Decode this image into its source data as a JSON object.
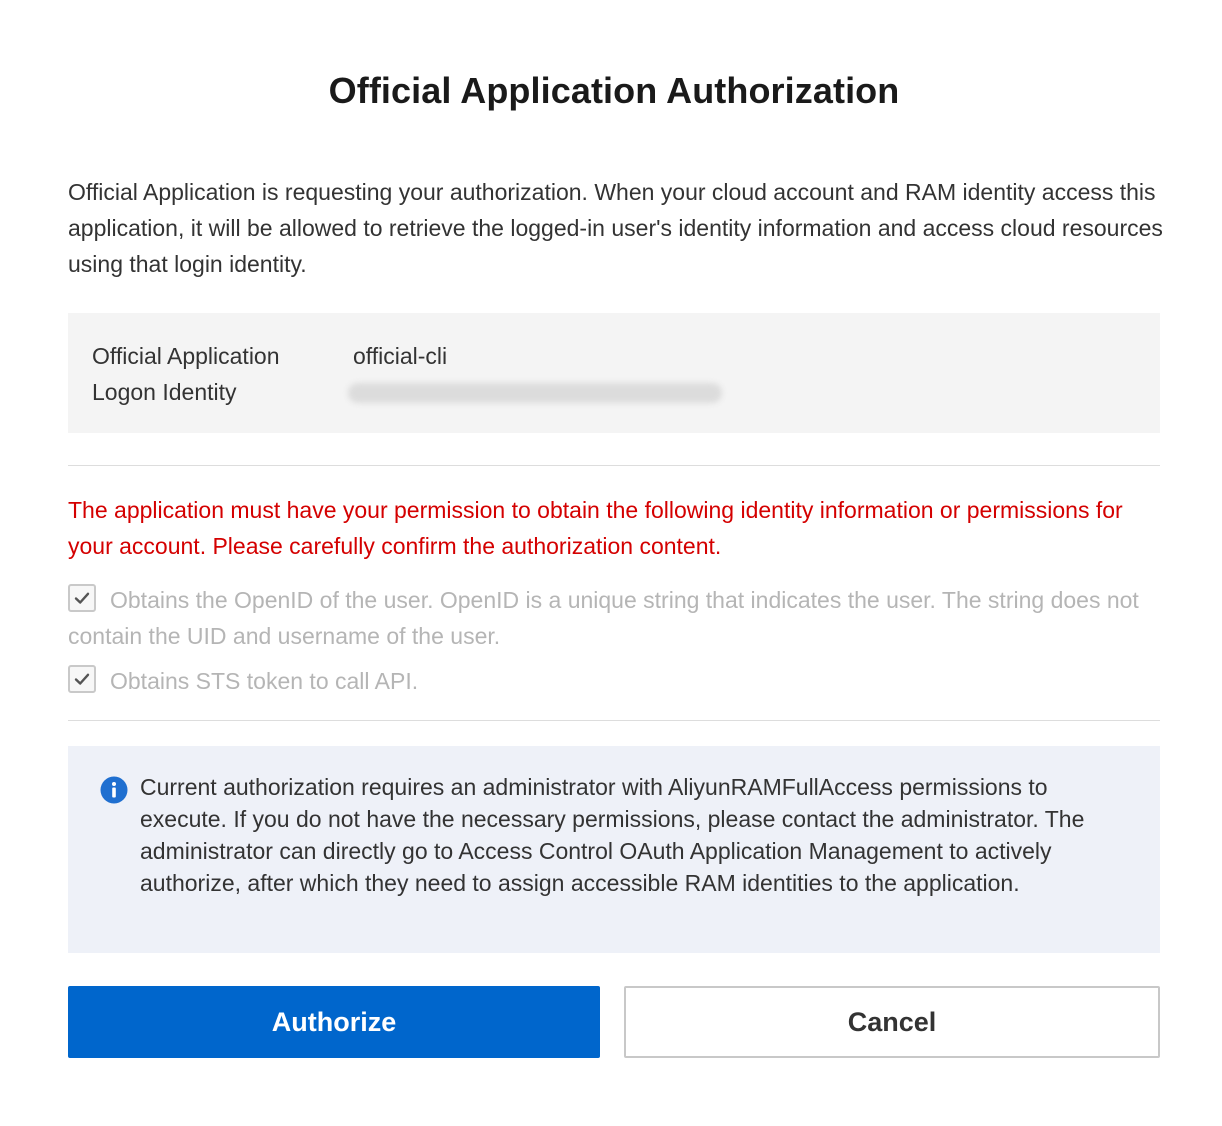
{
  "dialog": {
    "title": "Official Application Authorization",
    "intro": "Official Application is requesting your authorization. When your cloud account and RAM identity access this application, it will be allowed to retrieve the logged-in user's identity information and access cloud resources using that login identity."
  },
  "info": {
    "app_label": "Official Application",
    "app_value": "official-cli",
    "identity_label": "Logon Identity"
  },
  "warning": "The application must have your permission to obtain the following identity information or permissions for your account. Please carefully confirm the authorization content.",
  "permissions": [
    {
      "label": "Obtains the OpenID of the user. OpenID is a unique string that indicates the user. The string does not contain the UID and username of the user.",
      "checked": true,
      "disabled": true
    },
    {
      "label": "Obtains STS token to call API.",
      "checked": true,
      "disabled": true
    }
  ],
  "notice": {
    "icon": "info-icon",
    "text": "Current authorization requires an administrator with AliyunRAMFullAccess permissions to execute. If you do not have the necessary permissions, please contact the administrator. The administrator can directly go to Access Control OAuth Application Management to actively authorize, after which they need to assign accessible RAM identities to the application."
  },
  "buttons": {
    "authorize": "Authorize",
    "cancel": "Cancel"
  },
  "colors": {
    "primary": "#0066cc",
    "warning": "#d40000",
    "info_icon": "#1f6fd0",
    "notice_bg": "#eef1f8"
  }
}
